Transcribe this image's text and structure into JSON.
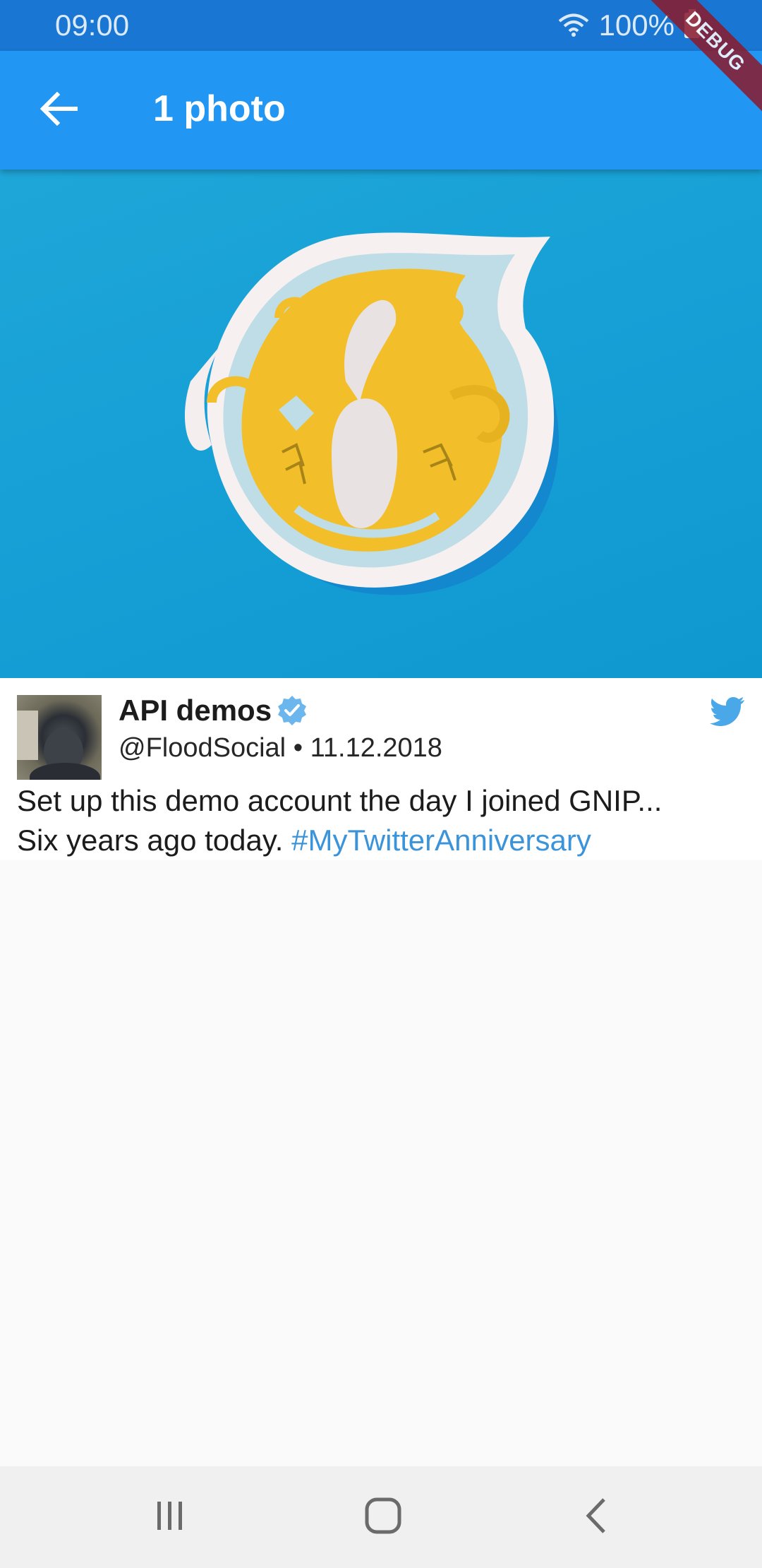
{
  "status_bar": {
    "time": "09:00",
    "battery": "100%"
  },
  "debug_banner": "DEBUG",
  "app_bar": {
    "title": "1 photo"
  },
  "tweet": {
    "name": "API demos",
    "handle": "@FloodSocial",
    "separator": "•",
    "date": "11.12.2018",
    "text_line1": "Set up this demo account the day I joined GNIP...",
    "text_line2": "Six years ago today.",
    "hashtag": "#MyTwitterAnniversary"
  },
  "colors": {
    "status_bar": "#1976d2",
    "app_bar": "#2196f3",
    "photo_bg": "#16a0d6",
    "twitter_blue": "#4aa8e8",
    "hashtag": "#3b94d9"
  },
  "icons": {
    "back": "arrow-left-icon",
    "verified": "verified-badge-icon",
    "twitter": "twitter-bird-icon",
    "wifi": "wifi-icon",
    "battery": "battery-icon",
    "nav_recents": "recents-icon",
    "nav_home": "home-icon",
    "nav_back": "back-chevron-icon"
  }
}
